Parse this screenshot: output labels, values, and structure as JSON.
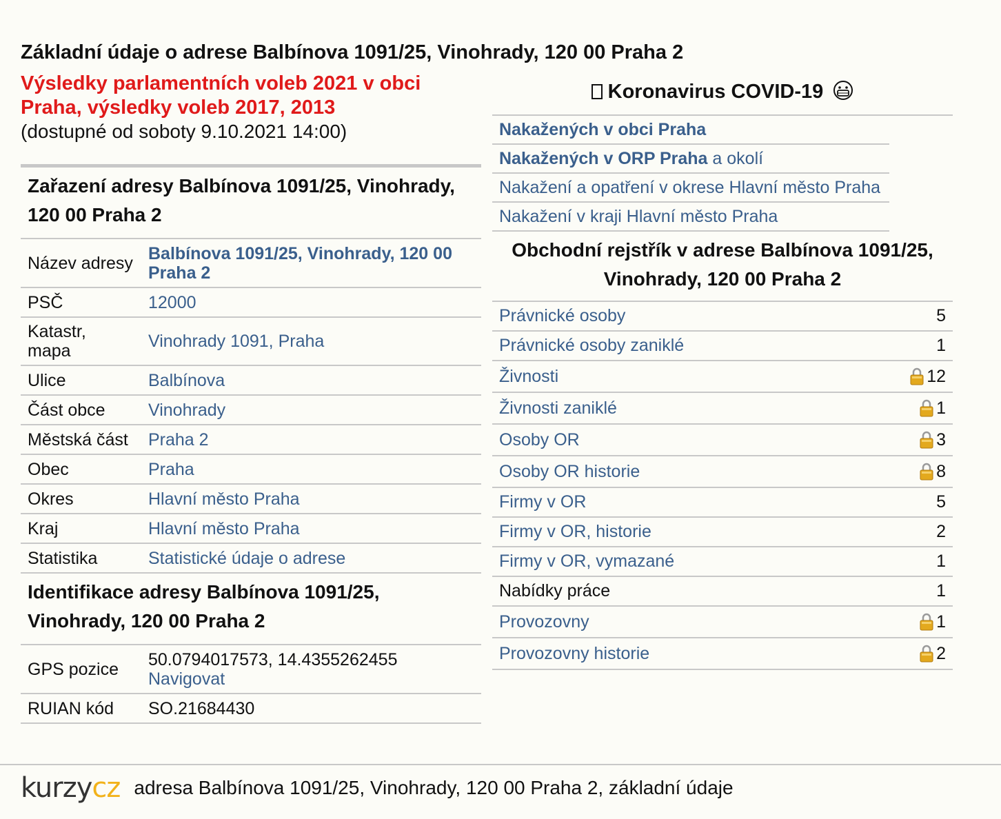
{
  "page_title": "Základní údaje o adrese Balbínova 1091/25, Vinohrady, 120 00 Praha 2",
  "election": {
    "title": "Výsledky parlamentních voleb 2021 v obci Praha, výsledky voleb 2017, 2013",
    "note": "(dostupné od soboty 9.10.2021 14:00)"
  },
  "zarazeni": {
    "heading": "Zařazení adresy Balbínova 1091/25, Vinohrady, 120 00 Praha 2",
    "rows": [
      {
        "key": "Název adresy",
        "value": "Balbínova 1091/25, Vinohrady, 120 00 Praha 2"
      },
      {
        "key": "PSČ",
        "value": "12000"
      },
      {
        "key": "Katastr, mapa",
        "value": "Vinohrady 1091, Praha"
      },
      {
        "key": "Ulice",
        "value": "Balbínova"
      },
      {
        "key": "Část obce",
        "value": "Vinohrady"
      },
      {
        "key": "Městská část",
        "value": "Praha 2"
      },
      {
        "key": "Obec",
        "value": "Praha"
      },
      {
        "key": "Okres",
        "value": "Hlavní město Praha"
      },
      {
        "key": "Kraj",
        "value": "Hlavní město Praha"
      },
      {
        "key": "Statistika",
        "value": "Statistické údaje o adrese"
      }
    ]
  },
  "identifikace": {
    "heading": "Identifikace adresy Balbínova 1091/25, Vinohrady, 120 00 Praha 2",
    "gps_key": "GPS pozice",
    "gps_value": "50.0794017573, 14.4355262455",
    "gps_link": "Navigovat",
    "ruian_key": "RUIAN kód",
    "ruian_value": "SO.21684430"
  },
  "covid": {
    "heading": "Koronavirus COVID-19",
    "items": {
      "obec": "Nakažených v obci Praha",
      "orp_bold": "Nakažených v ORP Praha",
      "orp_rest": " a okolí",
      "okres": "Nakažení a opatření v okrese Hlavní město Praha",
      "kraj": "Nakažení v kraji Hlavní město Praha"
    }
  },
  "obchodni": {
    "heading": "Obchodní rejstřík v adrese Balbínova 1091/25, Vinohrady, 120 00 Praha 2",
    "rows": [
      {
        "label": "Právnické osoby",
        "count": "5",
        "lock": false,
        "link": true
      },
      {
        "label": "Právnické osoby zaniklé",
        "count": "1",
        "lock": false,
        "link": true
      },
      {
        "label": "Živnosti",
        "count": "12",
        "lock": true,
        "link": true
      },
      {
        "label": "Živnosti zaniklé",
        "count": "1",
        "lock": true,
        "link": true
      },
      {
        "label": "Osoby OR",
        "count": "3",
        "lock": true,
        "link": true
      },
      {
        "label": "Osoby OR historie",
        "count": "8",
        "lock": true,
        "link": true
      },
      {
        "label": "Firmy v OR",
        "count": "5",
        "lock": false,
        "link": true
      },
      {
        "label": "Firmy v OR, historie",
        "count": "2",
        "lock": false,
        "link": true
      },
      {
        "label": "Firmy v OR, vymazané",
        "count": "1",
        "lock": false,
        "link": true
      },
      {
        "label": "Nabídky práce",
        "count": "1",
        "lock": false,
        "link": false
      },
      {
        "label": "Provozovny",
        "count": "1",
        "lock": true,
        "link": true
      },
      {
        "label": "Provozovny historie",
        "count": "2",
        "lock": true,
        "link": true
      }
    ]
  },
  "footer": {
    "logo_left": "kurzy",
    "logo_right": "cz",
    "text": "adresa Balbínova 1091/25, Vinohrady, 120 00 Praha 2, základní údaje"
  },
  "colors": {
    "link": "#3a5f8c",
    "election_red": "#e01a1a",
    "rule": "#c8c8c8",
    "lock_gold": "#e3a91e",
    "logo_gold": "#f2b21b"
  },
  "icons": [
    "lock-icon",
    "mask-emoji-icon",
    "virus-icon"
  ]
}
